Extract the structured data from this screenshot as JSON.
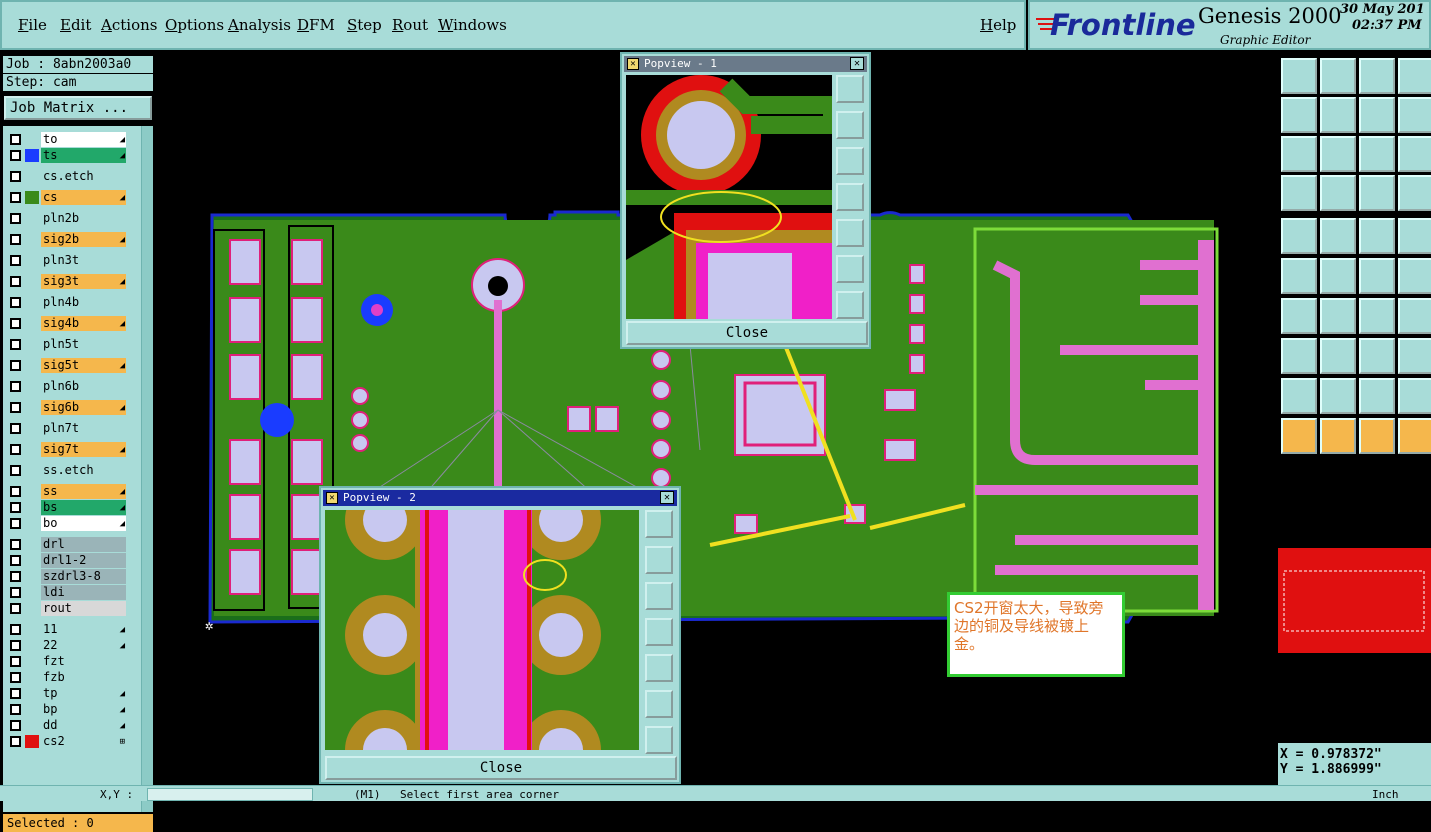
{
  "menu": {
    "items": [
      "File",
      "Edit",
      "Actions",
      "Options",
      "Analysis",
      "DFM",
      "Step",
      "Rout",
      "Windows"
    ],
    "help": "Help"
  },
  "brand": {
    "logo": "Frontline",
    "title": "Genesis 2000",
    "subtitle": "Graphic Editor",
    "date": "30 May 201",
    "time": "02:37 PM"
  },
  "job": {
    "job_label": "Job : 8abn2003a0",
    "step_label": "Step: cam",
    "matrix_button": "Job Matrix ..."
  },
  "layers": [
    {
      "name": "to",
      "color": "#ffffff",
      "swatch": "",
      "arrow": "◢"
    },
    {
      "name": "ts",
      "color": "#22a86a",
      "swatch": "#1a3cff",
      "arrow": "◢"
    },
    {
      "name": "cs.etch",
      "color": "#a8dcd8",
      "swatch": "",
      "arrow": ""
    },
    {
      "name": "cs",
      "color": "#f5b74c",
      "swatch": "#3a8a1a",
      "arrow": "◢"
    },
    {
      "name": "pln2b",
      "color": "#a8dcd8",
      "swatch": "",
      "arrow": ""
    },
    {
      "name": "sig2b",
      "color": "#f5b74c",
      "swatch": "",
      "arrow": "◢"
    },
    {
      "name": "pln3t",
      "color": "#a8dcd8",
      "swatch": "",
      "arrow": ""
    },
    {
      "name": "sig3t",
      "color": "#f5b74c",
      "swatch": "",
      "arrow": "◢"
    },
    {
      "name": "pln4b",
      "color": "#a8dcd8",
      "swatch": "",
      "arrow": ""
    },
    {
      "name": "sig4b",
      "color": "#f5b74c",
      "swatch": "",
      "arrow": "◢"
    },
    {
      "name": "pln5t",
      "color": "#a8dcd8",
      "swatch": "",
      "arrow": ""
    },
    {
      "name": "sig5t",
      "color": "#f5b74c",
      "swatch": "",
      "arrow": "◢"
    },
    {
      "name": "pln6b",
      "color": "#a8dcd8",
      "swatch": "",
      "arrow": ""
    },
    {
      "name": "sig6b",
      "color": "#f5b74c",
      "swatch": "",
      "arrow": "◢"
    },
    {
      "name": "pln7t",
      "color": "#a8dcd8",
      "swatch": "",
      "arrow": ""
    },
    {
      "name": "sig7t",
      "color": "#f5b74c",
      "swatch": "",
      "arrow": "◢"
    },
    {
      "name": "ss.etch",
      "color": "#a8dcd8",
      "swatch": "",
      "arrow": ""
    },
    {
      "name": "ss",
      "color": "#f5b74c",
      "swatch": "",
      "arrow": "◢"
    },
    {
      "name": "bs",
      "color": "#22a86a",
      "swatch": "",
      "arrow": "◢"
    },
    {
      "name": "bo",
      "color": "#ffffff",
      "swatch": "",
      "arrow": "◢"
    },
    {
      "name": "drl",
      "color": "#9ab4b8",
      "swatch": "",
      "arrow": ""
    },
    {
      "name": "drl1-2",
      "color": "#9ab4b8",
      "swatch": "",
      "arrow": ""
    },
    {
      "name": "szdrl3-8",
      "color": "#9ab4b8",
      "swatch": "",
      "arrow": ""
    },
    {
      "name": "ldi",
      "color": "#9ab4b8",
      "swatch": "",
      "arrow": ""
    },
    {
      "name": "rout",
      "color": "#d8d8d8",
      "swatch": "",
      "arrow": ""
    },
    {
      "name": "11",
      "color": "#a8dcd8",
      "swatch": "",
      "arrow": "◢"
    },
    {
      "name": "22",
      "color": "#a8dcd8",
      "swatch": "",
      "arrow": "◢"
    },
    {
      "name": "fzt",
      "color": "#a8dcd8",
      "swatch": "",
      "arrow": ""
    },
    {
      "name": "fzb",
      "color": "#a8dcd8",
      "swatch": "",
      "arrow": ""
    },
    {
      "name": "tp",
      "color": "#a8dcd8",
      "swatch": "",
      "arrow": "◢"
    },
    {
      "name": "bp",
      "color": "#a8dcd8",
      "swatch": "",
      "arrow": "◢"
    },
    {
      "name": "dd",
      "color": "#a8dcd8",
      "swatch": "",
      "arrow": "◢"
    },
    {
      "name": "cs2",
      "color": "#a8dcd8",
      "swatch": "#e01010",
      "arrow": "⊞"
    }
  ],
  "selected": "Selected : 0",
  "popview1": {
    "title": "Popview - 1",
    "close": "Close"
  },
  "popview2": {
    "title": "Popview - 2",
    "close": "Close"
  },
  "annotation": "CS2开窗太大，导致旁边的铜及导线被镀上金。",
  "coords": {
    "x": "X = 0.978372\"",
    "y": "Y = 1.886999\""
  },
  "status": {
    "xy_label": "X,Y :",
    "mode": "(M1)",
    "message": "Select first area corner",
    "unit": "Inch"
  }
}
